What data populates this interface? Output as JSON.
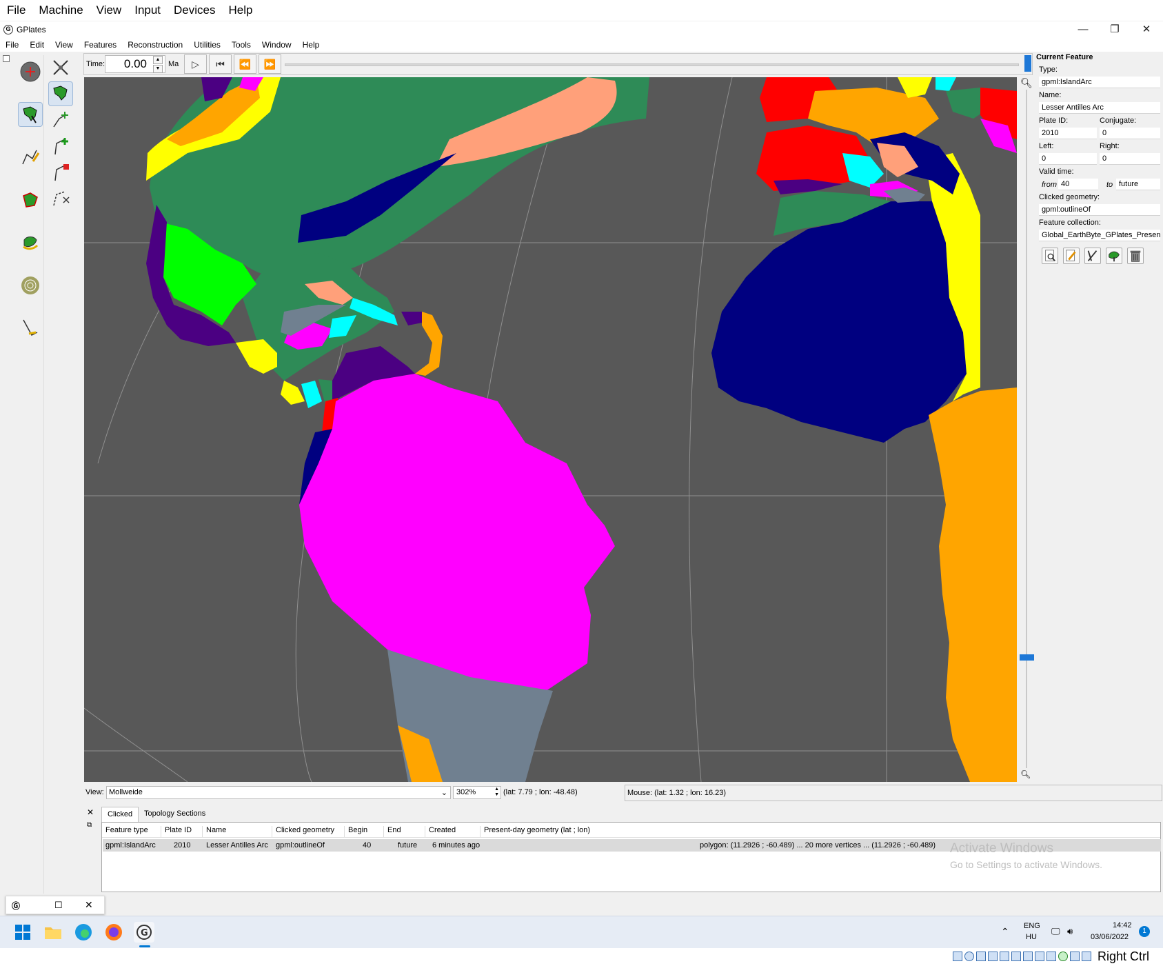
{
  "host_menu": [
    "File",
    "Machine",
    "View",
    "Input",
    "Devices",
    "Help"
  ],
  "window": {
    "title": "GPlates",
    "logo": "G",
    "minimize": "—",
    "maximize": "❐",
    "close": "✕"
  },
  "app_menu": [
    "File",
    "Edit",
    "View",
    "Features",
    "Reconstruction",
    "Utilities",
    "Tools",
    "Window",
    "Help"
  ],
  "tools_left": [
    "drag-globe-icon",
    "choose-feature-icon",
    "digitise-geometry-icon",
    "build-topology-icon",
    "edit-topology-icon",
    "small-circle-icon",
    "measure-distance-icon"
  ],
  "tools_right": [
    "move-pole-icon",
    "plate-reconstruction-icon",
    "move-vertex-icon",
    "insert-vertex-icon",
    "delete-vertex-icon",
    "split-feature-icon"
  ],
  "timebar": {
    "label": "Time:",
    "value": "0.00",
    "unit": "Ma",
    "buttons": [
      "play",
      "reset",
      "step-back",
      "step-forward"
    ]
  },
  "globe": {
    "background": "#585858"
  },
  "status": {
    "view_label": "View:",
    "projection": "Mollweide",
    "zoom": "302%",
    "camera": "(lat: 7.79 ; lon: -48.48)",
    "mouse": "Mouse: (lat: 1.32 ; lon: 16.23)"
  },
  "dock": {
    "close": "✕",
    "float": "⧉",
    "tabs": [
      "Clicked",
      "Topology Sections"
    ],
    "columns": [
      "Feature type",
      "Plate ID",
      "Name",
      "Clicked geometry",
      "Begin",
      "End",
      "Created",
      "Present-day geometry (lat ; lon)"
    ],
    "rows": [
      {
        "feature_type": "gpml:IslandArc",
        "plate_id": "2010",
        "name": "Lesser Antilles Arc",
        "clicked_geometry": "gpml:outlineOf",
        "begin": "40",
        "end": "future",
        "created": "6 minutes ago",
        "geometry": "polygon: (11.2926 ; -60.489) ... 20 more vertices ... (11.2926 ; -60.489)"
      }
    ]
  },
  "current_feature": {
    "heading": "Current Feature",
    "type_label": "Type:",
    "type": "gpml:IslandArc",
    "name_label": "Name:",
    "name": "Lesser Antilles Arc",
    "plate_id_label": "Plate ID:",
    "plate_id": "2010",
    "conjugate_label": "Conjugate:",
    "conjugate": "0",
    "left_label": "Left:",
    "left": "0",
    "right_label": "Right:",
    "right": "0",
    "valid_time_label": "Valid time:",
    "from_label": "from",
    "from": "40",
    "to_label": "to",
    "to": "future",
    "clicked_geometry_label": "Clicked geometry:",
    "clicked_geometry": "gpml:outlineOf",
    "feature_collection_label": "Feature collection:",
    "feature_collection": "Global_EarthByte_GPlates_PresentD",
    "actions": [
      "query-feature-icon",
      "edit-feature-icon",
      "manage-pole-icon",
      "reconstruction-pole-icon",
      "delete-feature-icon"
    ]
  },
  "watermark": {
    "line1": "Activate Windows",
    "line2": "Go to Settings to activate Windows."
  },
  "taskbar": {
    "apps": [
      "start-icon",
      "file-explorer-icon",
      "edge-icon",
      "firefox-icon",
      "gplates-icon"
    ],
    "language": "ENG",
    "region": "HU",
    "time": "14:42",
    "date": "03/06/2022",
    "notifications": "1"
  },
  "host_strip": {
    "hotkey": "Right Ctrl"
  },
  "colors": {
    "accent": "#1e78d7",
    "south_america": "#ff00ff",
    "africa": "#000080",
    "north_america": "#2e8b57"
  }
}
